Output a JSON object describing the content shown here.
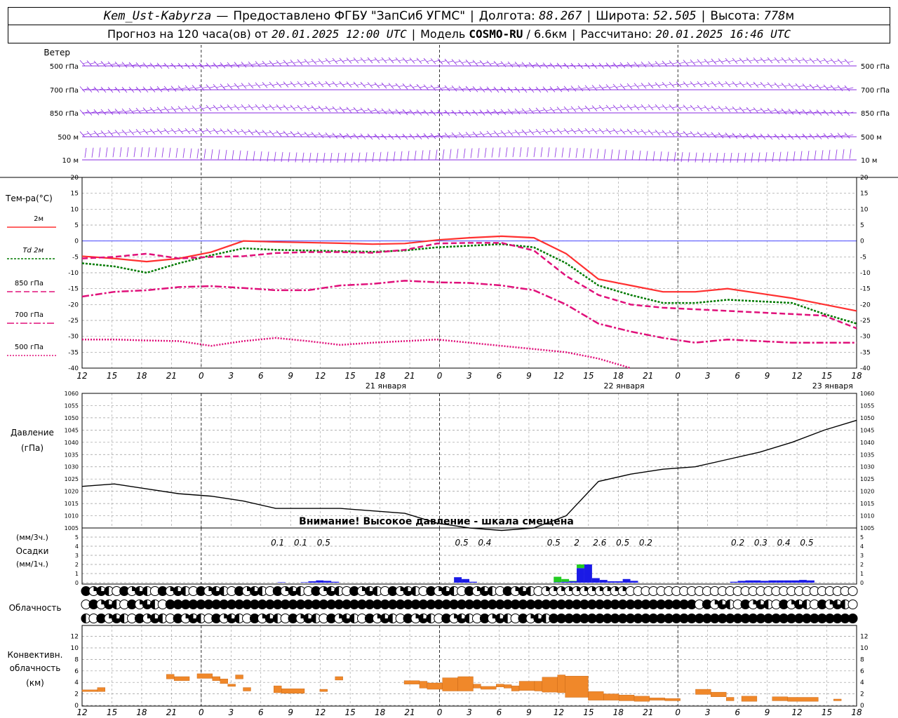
{
  "header": {
    "station": "Kem_Ust-Kabyrza",
    "provider": "Предоставлено ФГБУ \"ЗапСиб УГМС\"",
    "lon_label": "Долгота:",
    "lon_value": "88.267",
    "lat_label": "Широта:",
    "lat_value": "52.505",
    "alt_label": "Высота:",
    "alt_value": "778",
    "alt_unit": "м",
    "forecast_prefix": "Прогноз на 120 часа(ов) от",
    "forecast_start": "20.01.2025 12:00 UTC",
    "model_label": "Модель",
    "model_name": "COSMO-RU",
    "model_res": "/ 6.6км",
    "calc_label": "Рассчитано:",
    "calc_time": "20.01.2025 16:46 UTC"
  },
  "colors": {
    "t2m": "#ff3030",
    "td2m": "#007a00",
    "t850": "#e0107a",
    "t700": "#e0107a",
    "t500": "#e0107a",
    "wind": "#8a2be2",
    "precip": "#1a1ae6",
    "precip_snow": "#22cc22",
    "convective": "#f0882a",
    "zero_line": "#4444ff"
  },
  "chart_data": [
    {
      "type": "wind_barbs",
      "title": "Ветер",
      "levels": [
        "500 гПа",
        "700 гПа",
        "850 гПа",
        "500 м",
        "10 м"
      ]
    },
    {
      "type": "line",
      "title": "Тем-ра(°С)",
      "ylim": [
        -40,
        20
      ],
      "yticks": [
        20,
        15,
        10,
        5,
        0,
        -5,
        -10,
        -15,
        -20,
        -25,
        -30,
        -35,
        -40
      ],
      "x_hours": [
        0,
        3,
        6,
        9,
        12,
        15,
        18,
        21,
        24,
        27,
        30,
        33,
        36,
        39,
        42,
        45,
        48,
        51,
        54,
        57,
        60,
        63,
        66,
        69,
        72,
        75,
        78
      ],
      "x_tick_labels": [
        "12",
        "15",
        "18",
        "21",
        "0",
        "3",
        "6",
        "9",
        "12",
        "15",
        "18",
        "21",
        "0",
        "3",
        "6",
        "9",
        "12",
        "15",
        "18",
        "21",
        "0",
        "3",
        "6",
        "9",
        "12",
        "15",
        "18"
      ],
      "day_labels": [
        {
          "hour": 32,
          "label": "21 января"
        },
        {
          "hour": 56,
          "label": "22 января"
        },
        {
          "hour": 77,
          "label": "23 января"
        }
      ],
      "series": [
        {
          "name": "2м",
          "values": [
            -4.8,
            -5.5,
            -6.5,
            -5.5,
            -3.5,
            0.0,
            -0.3,
            -0.5,
            -0.7,
            -1.0,
            -0.8,
            0.3,
            1.0,
            1.5,
            1.0,
            -4,
            -12,
            -14,
            -16,
            -16,
            -15,
            -16.5,
            -18,
            -20,
            -22
          ]
        },
        {
          "name": "Td 2м",
          "values": [
            -7,
            -8,
            -10,
            -7,
            -4.5,
            -2.3,
            -2.8,
            -3,
            -3.2,
            -3.4,
            -3,
            -2,
            -1.5,
            -1.0,
            -2,
            -7,
            -14,
            -17,
            -19.5,
            -19.5,
            -18.5,
            -19,
            -19.5,
            -23,
            -26
          ]
        },
        {
          "name": "850 гПа",
          "values": [
            -5.5,
            -5,
            -4,
            -5.5,
            -5,
            -4.8,
            -3.8,
            -3.5,
            -3.5,
            -3.7,
            -2.8,
            -0.8,
            -0.6,
            -0.6,
            -3,
            -11,
            -17,
            -20,
            -21,
            -21.5,
            -22,
            -22.5,
            -23,
            -23.5,
            -27.5
          ]
        },
        {
          "name": "700 гПа",
          "values": [
            -17.5,
            -16,
            -15.5,
            -14.5,
            -14.2,
            -14.8,
            -15.5,
            -15.5,
            -14,
            -13.5,
            -12.5,
            -13,
            -13.2,
            -14,
            -15.5,
            -20,
            -26,
            -28.5,
            -30.5,
            -32,
            -31,
            -31.5,
            -32,
            -32,
            -32
          ]
        },
        {
          "name": "500 гПа",
          "values": [
            -31,
            -31,
            -31.3,
            -31.5,
            -33,
            -31.5,
            -30.5,
            -31.5,
            -32.7,
            -32,
            -31.5,
            -31,
            -32,
            -33,
            -34,
            -35,
            -37,
            -40
          ]
        }
      ]
    },
    {
      "type": "line",
      "title": "Давление",
      "unit": "(гПа)",
      "ylim": [
        1005,
        1060
      ],
      "yticks": [
        1060,
        1055,
        1050,
        1045,
        1040,
        1035,
        1030,
        1025,
        1020,
        1015,
        1010,
        1005
      ],
      "annotation": "Внимание! Высокое давление - шкала смещена",
      "series": [
        {
          "name": "",
          "values": [
            1022,
            1023,
            1021,
            1019,
            1018,
            1016,
            1013,
            1013,
            1013,
            1012,
            1011,
            1007,
            1005,
            1004,
            1005,
            1010,
            1024,
            1027,
            1029,
            1030,
            1033,
            1036,
            1040,
            1045,
            1049
          ]
        }
      ]
    },
    {
      "type": "bar",
      "title": "Осадки",
      "unit_3h": "(мм/3ч.)",
      "unit_1h": "(мм/1ч.)",
      "ylim": [
        0,
        5
      ],
      "yticks": [
        5,
        4,
        3,
        2,
        1,
        0
      ],
      "totals_3h": [
        {
          "hour": 25.5,
          "value": "0.1"
        },
        {
          "hour": 28.5,
          "value": "0.1"
        },
        {
          "hour": 31.5,
          "value": "0.5"
        },
        {
          "hour": 49.5,
          "value": "0.5"
        },
        {
          "hour": 52.5,
          "value": "0.4"
        },
        {
          "hour": 61.5,
          "value": "0.5"
        },
        {
          "hour": 64.5,
          "value": "2"
        },
        {
          "hour": 67.5,
          "value": "2.6"
        },
        {
          "hour": 70.5,
          "value": "0.5"
        },
        {
          "hour": 73.5,
          "value": "0.2"
        },
        {
          "hour": 85.5,
          "value": "0.2"
        },
        {
          "hour": 88.5,
          "value": "0.3"
        },
        {
          "hour": 91.5,
          "value": "0.4"
        },
        {
          "hour": 94.5,
          "value": "0.5"
        }
      ],
      "hourly": [
        {
          "hour": 26,
          "rain": 0.05
        },
        {
          "hour": 29,
          "rain": 0.05
        },
        {
          "hour": 30,
          "rain": 0.15
        },
        {
          "hour": 31,
          "rain": 0.25
        },
        {
          "hour": 32,
          "rain": 0.2
        },
        {
          "hour": 33,
          "rain": 0.1
        },
        {
          "hour": 49,
          "rain": 0.6
        },
        {
          "hour": 50,
          "rain": 0.4
        },
        {
          "hour": 51,
          "rain": 0.1
        },
        {
          "hour": 62,
          "rain": 0.05,
          "snow": 0.6
        },
        {
          "hour": 63,
          "rain": 0.1,
          "snow": 0.3
        },
        {
          "hour": 64,
          "rain": 0.15,
          "snow": 0.05
        },
        {
          "hour": 65,
          "rain": 1.6,
          "snow": 0.4
        },
        {
          "hour": 66,
          "rain": 2.0
        },
        {
          "hour": 67,
          "rain": 0.5
        },
        {
          "hour": 68,
          "rain": 0.3
        },
        {
          "hour": 69,
          "rain": 0.15
        },
        {
          "hour": 70,
          "rain": 0.15
        },
        {
          "hour": 71,
          "rain": 0.4
        },
        {
          "hour": 72,
          "rain": 0.2
        },
        {
          "hour": 85,
          "rain": 0.1
        },
        {
          "hour": 86,
          "rain": 0.2
        },
        {
          "hour": 87,
          "rain": 0.25
        },
        {
          "hour": 88,
          "rain": 0.25
        },
        {
          "hour": 89,
          "rain": 0.2
        },
        {
          "hour": 90,
          "rain": 0.25
        },
        {
          "hour": 91,
          "rain": 0.25
        },
        {
          "hour": 92,
          "rain": 0.25
        },
        {
          "hour": 93,
          "rain": 0.25
        },
        {
          "hour": 94,
          "rain": 0.3
        },
        {
          "hour": 95,
          "rain": 0.25
        }
      ]
    },
    {
      "type": "cloud_symbols",
      "title": "Облачность",
      "rows": 3
    },
    {
      "type": "bar",
      "title": "Конвективн. облачность",
      "unit": "(км)",
      "ylim": [
        0,
        13
      ],
      "yticks": [
        12,
        10,
        8,
        6,
        4,
        2,
        0
      ],
      "segments": [
        {
          "h0": 0,
          "h1": 2,
          "bottom": 2.4,
          "top": 2.7
        },
        {
          "h0": 2,
          "h1": 3,
          "bottom": 2.4,
          "top": 3.1
        },
        {
          "h0": 11,
          "h1": 12,
          "bottom": 4.6,
          "top": 5.4
        },
        {
          "h0": 12,
          "h1": 14,
          "bottom": 4.3,
          "top": 5.0
        },
        {
          "h0": 15,
          "h1": 17,
          "bottom": 4.7,
          "top": 5.5
        },
        {
          "h0": 17,
          "h1": 18,
          "bottom": 4.3,
          "top": 5.0
        },
        {
          "h0": 18,
          "h1": 19,
          "bottom": 3.8,
          "top": 4.6
        },
        {
          "h0": 19,
          "h1": 20,
          "bottom": 3.3,
          "top": 3.7
        },
        {
          "h0": 20,
          "h1": 21,
          "bottom": 4.6,
          "top": 5.3
        },
        {
          "h0": 21,
          "h1": 22,
          "bottom": 2.5,
          "top": 3.1
        },
        {
          "h0": 25,
          "h1": 26,
          "bottom": 2.2,
          "top": 3.4
        },
        {
          "h0": 26,
          "h1": 29,
          "bottom": 2.1,
          "top": 2.9
        },
        {
          "h0": 31,
          "h1": 32,
          "bottom": 2.4,
          "top": 2.8
        },
        {
          "h0": 33,
          "h1": 34,
          "bottom": 4.4,
          "top": 5.0
        },
        {
          "h0": 42,
          "h1": 44,
          "bottom": 3.7,
          "top": 4.3
        },
        {
          "h0": 44,
          "h1": 45,
          "bottom": 3.0,
          "top": 4.2
        },
        {
          "h0": 45,
          "h1": 47,
          "bottom": 2.8,
          "top": 3.9
        },
        {
          "h0": 47,
          "h1": 49,
          "bottom": 2.5,
          "top": 4.8
        },
        {
          "h0": 49,
          "h1": 51,
          "bottom": 2.5,
          "top": 5.0
        },
        {
          "h0": 51,
          "h1": 52,
          "bottom": 3.0,
          "top": 3.7
        },
        {
          "h0": 52,
          "h1": 54,
          "bottom": 2.8,
          "top": 3.3
        },
        {
          "h0": 54,
          "h1": 55,
          "bottom": 3.2,
          "top": 3.7
        },
        {
          "h0": 55,
          "h1": 56,
          "bottom": 3.0,
          "top": 3.6
        },
        {
          "h0": 56,
          "h1": 57,
          "bottom": 2.5,
          "top": 3.4
        },
        {
          "h0": 57,
          "h1": 59,
          "bottom": 2.6,
          "top": 4.2
        },
        {
          "h0": 59,
          "h1": 60,
          "bottom": 2.5,
          "top": 4.2
        },
        {
          "h0": 60,
          "h1": 62,
          "bottom": 2.3,
          "top": 4.9
        },
        {
          "h0": 62,
          "h1": 63,
          "bottom": 2.2,
          "top": 5.3
        },
        {
          "h0": 63,
          "h1": 66,
          "bottom": 1.4,
          "top": 5.1
        },
        {
          "h0": 66,
          "h1": 68,
          "bottom": 0.9,
          "top": 2.4
        },
        {
          "h0": 68,
          "h1": 70,
          "bottom": 0.9,
          "top": 2.0
        },
        {
          "h0": 70,
          "h1": 72,
          "bottom": 0.8,
          "top": 1.8
        },
        {
          "h0": 72,
          "h1": 74,
          "bottom": 0.7,
          "top": 1.6
        },
        {
          "h0": 74,
          "h1": 76,
          "bottom": 0.9,
          "top": 1.3
        },
        {
          "h0": 76,
          "h1": 78,
          "bottom": 0.8,
          "top": 1.2
        },
        {
          "h0": 80,
          "h1": 82,
          "bottom": 1.9,
          "top": 2.8
        },
        {
          "h0": 82,
          "h1": 84,
          "bottom": 1.5,
          "top": 2.3
        },
        {
          "h0": 84,
          "h1": 85,
          "bottom": 0.8,
          "top": 1.4
        },
        {
          "h0": 86,
          "h1": 88,
          "bottom": 0.7,
          "top": 1.6
        },
        {
          "h0": 90,
          "h1": 92,
          "bottom": 0.8,
          "top": 1.5
        },
        {
          "h0": 92,
          "h1": 96,
          "bottom": 0.7,
          "top": 1.4
        },
        {
          "h0": 98,
          "h1": 99,
          "bottom": 0.8,
          "top": 1.1
        }
      ]
    }
  ]
}
